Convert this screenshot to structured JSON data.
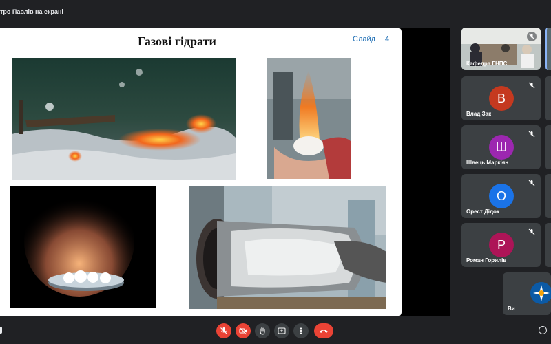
{
  "topbar": {
    "presenting_label": "тро Павлів на екрані"
  },
  "slide": {
    "title": "Газові гідрати",
    "slide_word": "Слайд",
    "slide_number": "4"
  },
  "participants": [
    {
      "name": "Кафедра ГНПС",
      "type": "video",
      "muted": true
    },
    {
      "name": "Влад Зак",
      "initial": "В",
      "color": "#c5391f",
      "muted": true
    },
    {
      "name": "Швець Маркіян",
      "initial": "Ш",
      "color": "#9c27b0",
      "muted": true
    },
    {
      "name": "Орест Дідок",
      "initial": "О",
      "color": "#1a73e8",
      "muted": true
    },
    {
      "name": "Роман Горилів",
      "initial": "Р",
      "color": "#ad1457",
      "muted": true
    },
    {
      "name": "Ви",
      "type": "self-logo",
      "muted": false
    }
  ],
  "controls": [
    {
      "name": "microphone-off",
      "icon": "mic-off-icon",
      "color": "#ea4335"
    },
    {
      "name": "camera-off",
      "icon": "camera-off-icon",
      "color": "#ea4335"
    },
    {
      "name": "raise-hand",
      "icon": "hand-icon",
      "color": "#3c4043"
    },
    {
      "name": "present-now",
      "icon": "present-icon",
      "color": "#3c4043"
    },
    {
      "name": "more-options",
      "icon": "more-vert-icon",
      "color": "#3c4043"
    },
    {
      "name": "end-call",
      "icon": "phone-hangup-icon",
      "color": "#ea4335"
    }
  ]
}
